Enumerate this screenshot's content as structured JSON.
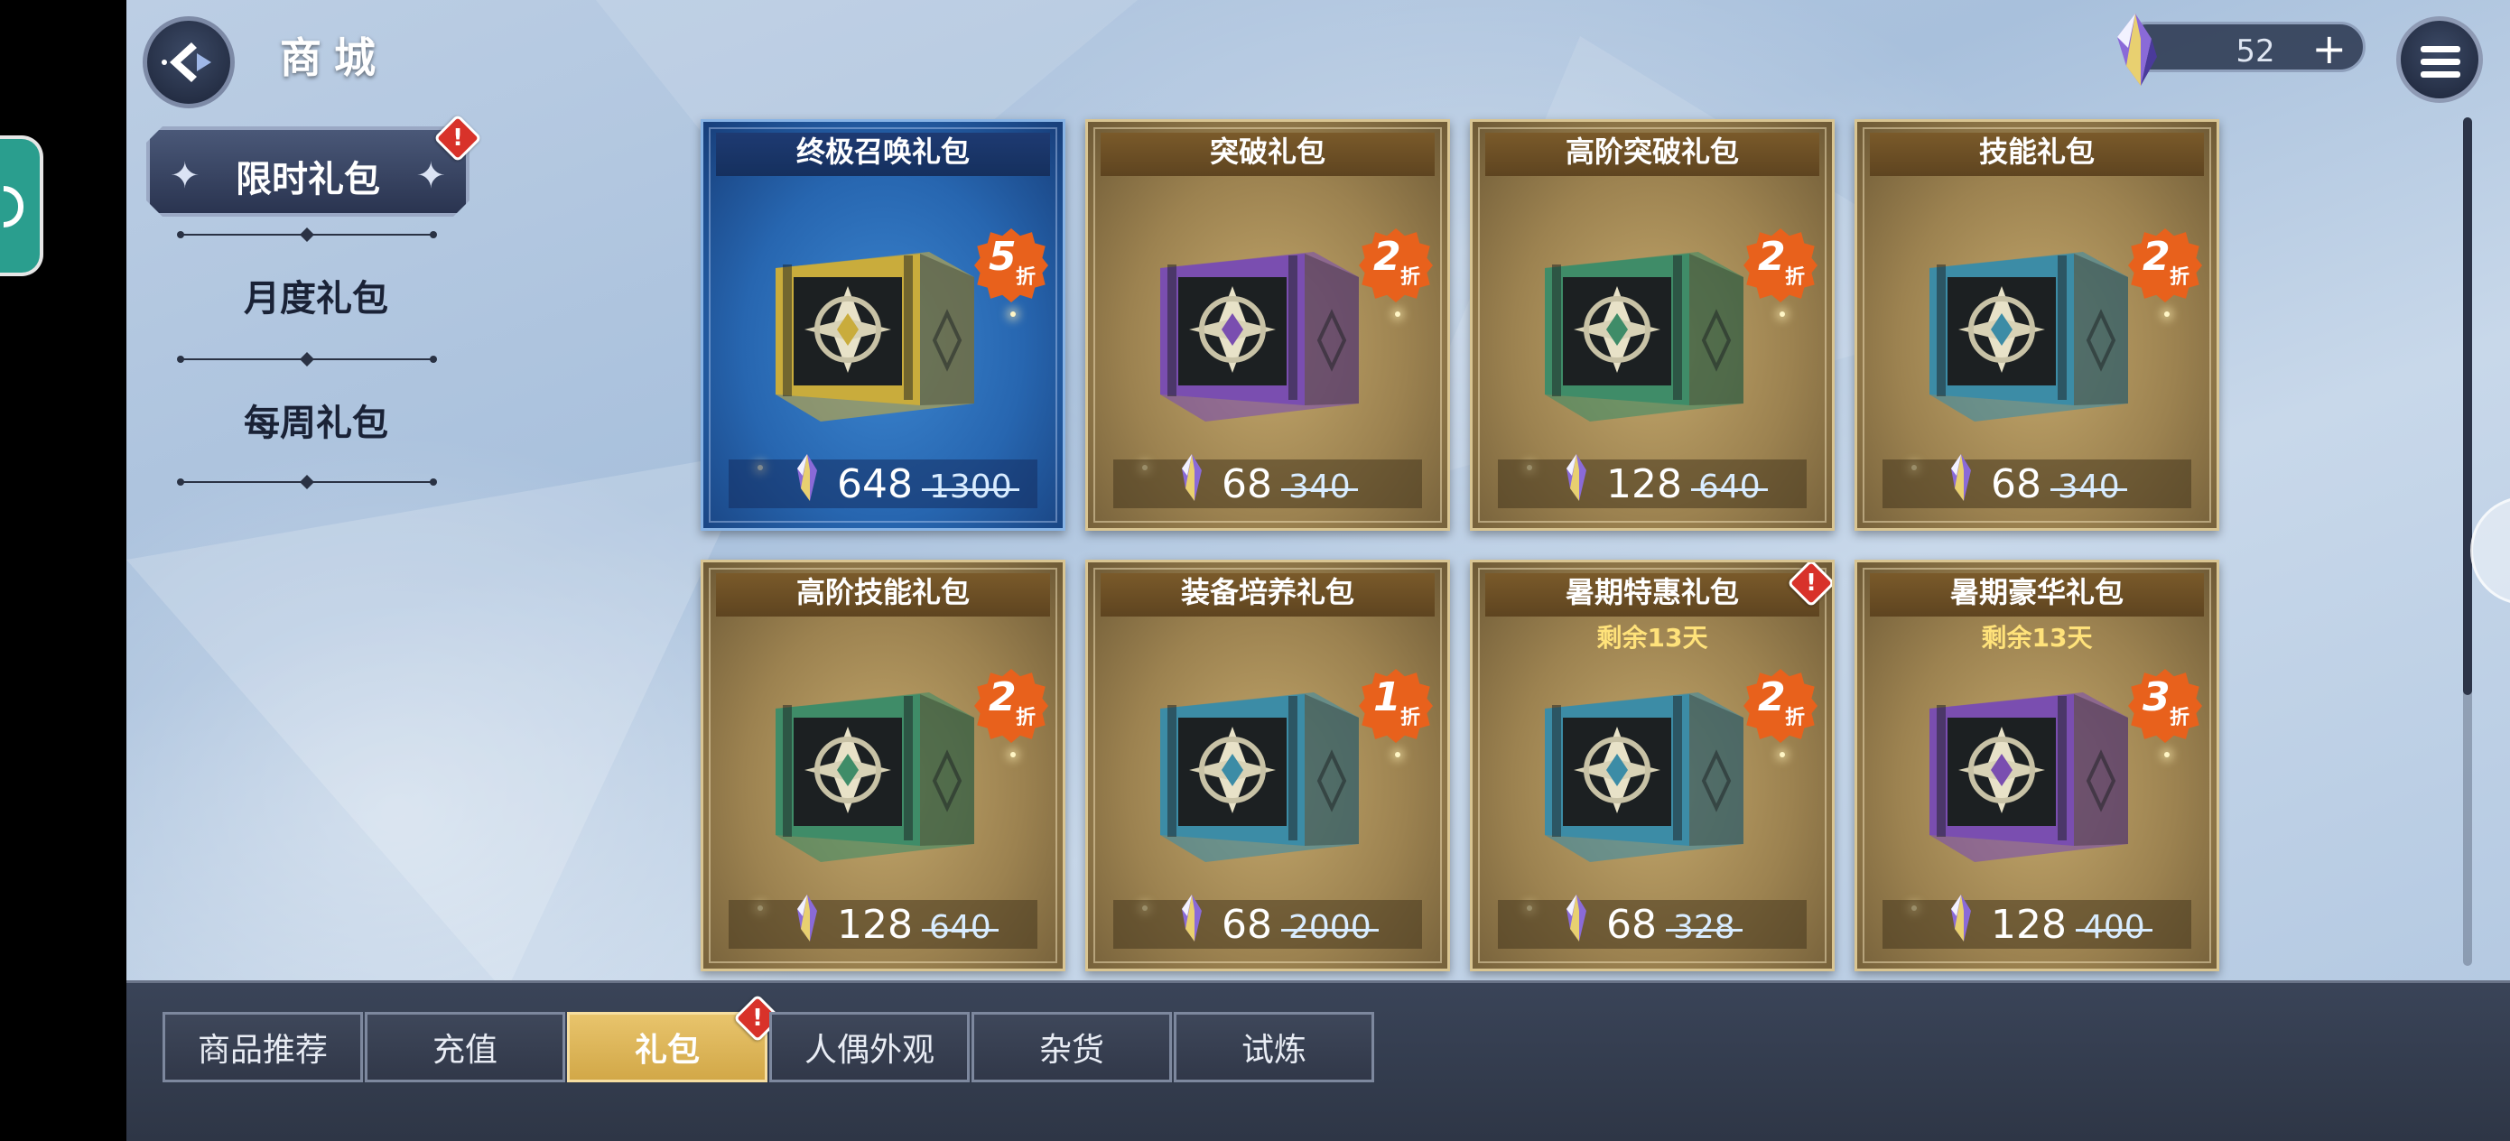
{
  "header": {
    "title": "商城"
  },
  "currency": {
    "value": "52",
    "plus_label": "+"
  },
  "categories": [
    {
      "label": "限时礼包",
      "active": true,
      "alert": "!"
    },
    {
      "label": "月度礼包",
      "active": false
    },
    {
      "label": "每周礼包",
      "active": false
    }
  ],
  "packs": [
    {
      "title": "终极召唤礼包",
      "subtitle": "",
      "discount": "5",
      "discount_unit": "折",
      "price": "648",
      "original_price": "1300",
      "theme": "blue",
      "chest_color": "gold",
      "alert": ""
    },
    {
      "title": "突破礼包",
      "subtitle": "",
      "discount": "2",
      "discount_unit": "折",
      "price": "68",
      "original_price": "340",
      "theme": "gold",
      "chest_color": "purple",
      "alert": ""
    },
    {
      "title": "高阶突破礼包",
      "subtitle": "",
      "discount": "2",
      "discount_unit": "折",
      "price": "128",
      "original_price": "640",
      "theme": "gold",
      "chest_color": "green",
      "alert": ""
    },
    {
      "title": "技能礼包",
      "subtitle": "",
      "discount": "2",
      "discount_unit": "折",
      "price": "68",
      "original_price": "340",
      "theme": "gold",
      "chest_color": "teal",
      "alert": ""
    },
    {
      "title": "高阶技能礼包",
      "subtitle": "",
      "discount": "2",
      "discount_unit": "折",
      "price": "128",
      "original_price": "640",
      "theme": "gold",
      "chest_color": "green",
      "alert": ""
    },
    {
      "title": "装备培养礼包",
      "subtitle": "",
      "discount": "1",
      "discount_unit": "折",
      "price": "68",
      "original_price": "2000",
      "theme": "gold",
      "chest_color": "teal",
      "alert": ""
    },
    {
      "title": "暑期特惠礼包",
      "subtitle": "剩余13天",
      "discount": "2",
      "discount_unit": "折",
      "price": "68",
      "original_price": "328",
      "theme": "gold",
      "chest_color": "teal",
      "alert": "!"
    },
    {
      "title": "暑期豪华礼包",
      "subtitle": "剩余13天",
      "discount": "3",
      "discount_unit": "折",
      "price": "128",
      "original_price": "400",
      "theme": "gold",
      "chest_color": "purple",
      "alert": ""
    }
  ],
  "tabs": [
    {
      "label": "商品推荐",
      "active": false
    },
    {
      "label": "充值",
      "active": false
    },
    {
      "label": "礼包",
      "active": true,
      "alert": "!"
    },
    {
      "label": "人偶外观",
      "active": false
    },
    {
      "label": "杂货",
      "active": false
    },
    {
      "label": "试炼",
      "active": false
    }
  ],
  "colors": {
    "chest_gold": "#c9ac3c",
    "chest_purple": "#7a4eb0",
    "chest_green": "#3f8c68",
    "chest_teal": "#3c8ca6",
    "discount_badge": "#e8611c",
    "active_tab": "#d6ad4e"
  }
}
